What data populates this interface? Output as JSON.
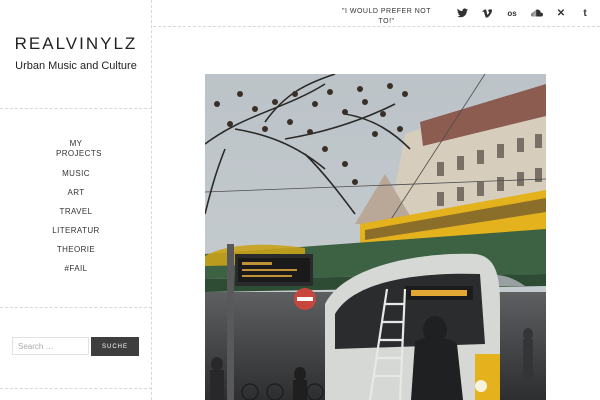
{
  "site": {
    "title": "REALVINYLZ",
    "description": "Urban Music and Culture"
  },
  "nav": {
    "items": [
      "MY PROJECTS",
      "MUSIC",
      "ART",
      "TRAVEL",
      "LITERATUR",
      "THEORIE",
      "#FAIL"
    ]
  },
  "search": {
    "placeholder": "Search …",
    "button_label": "SUCHE"
  },
  "header": {
    "tagline": "\"I WOULD PREFER NOT TO!\"",
    "social_icons": [
      "twitter-icon",
      "vimeo-icon",
      "lastfm-icon",
      "soundcloud-icon",
      "xing-icon",
      "tumblr-icon"
    ]
  },
  "post": {
    "image_alt": "Berlin street with yellow tram and S-Bahn on bridge"
  },
  "colors": {
    "button_bg": "#3e3e3e",
    "tram_yellow": "#e8b400",
    "bridge_green": "#3b5f3e"
  }
}
